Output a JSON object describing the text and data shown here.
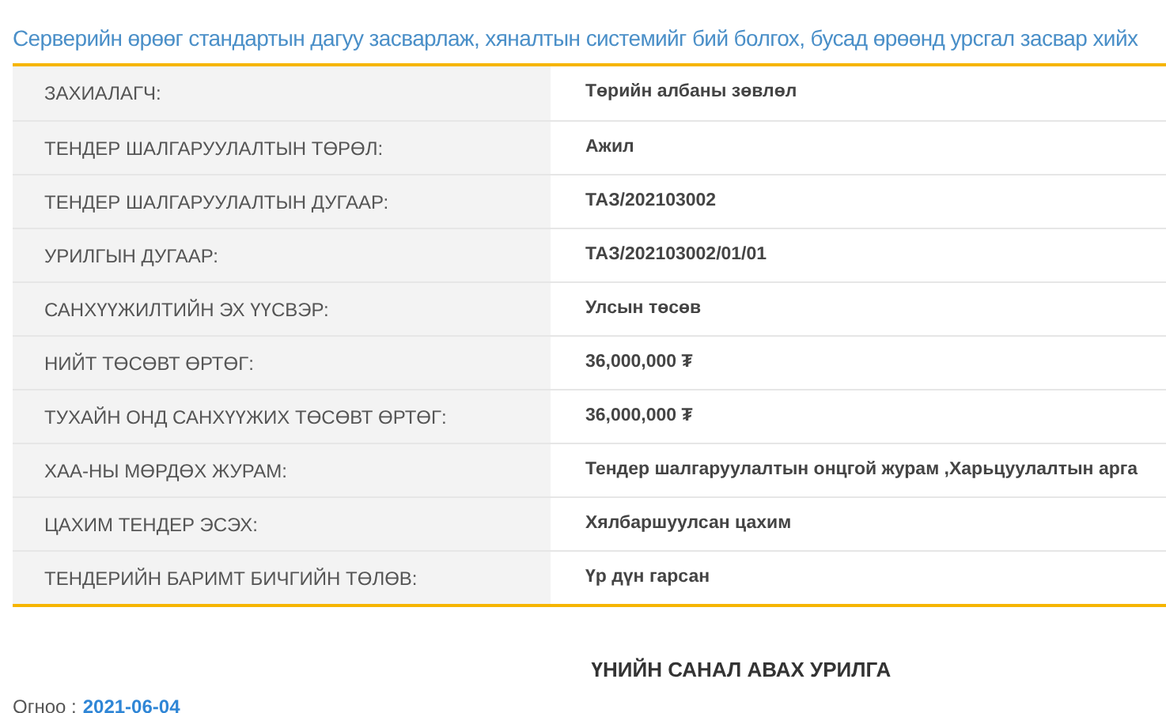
{
  "title": "Серверийн өрөөг стандартын дагуу засварлаж, хяналтын системийг бий болгох, бусад өрөөнд урсгал засвар хийх",
  "details": [
    {
      "label": "ЗАХИАЛАГЧ:",
      "value": "Төрийн албаны зөвлөл"
    },
    {
      "label": "ТЕНДЕР ШАЛГАРУУЛАЛТЫН ТӨРӨЛ:",
      "value": "Ажил"
    },
    {
      "label": "ТЕНДЕР ШАЛГАРУУЛАЛТЫН ДУГААР:",
      "value": "ТАЗ/202103002"
    },
    {
      "label": "УРИЛГЫН ДУГААР:",
      "value": "ТАЗ/202103002/01/01"
    },
    {
      "label": "САНХҮҮЖИЛТИЙН ЭХ ҮҮСВЭР:",
      "value": "Улсын төсөв"
    },
    {
      "label": "НИЙТ ТӨСӨВТ ӨРТӨГ:",
      "value": "36,000,000 ₮"
    },
    {
      "label": "ТУХАЙН ОНД САНХҮҮЖИХ ТӨСӨВТ ӨРТӨГ:",
      "value": "36,000,000 ₮"
    },
    {
      "label": "ХАА-НЫ МӨРДӨХ ЖУРАМ:",
      "value": "Тендер шалгаруулалтын онцгой журам ,Харьцуулалтын арга"
    },
    {
      "label": "ЦАХИМ ТЕНДЕР ЭСЭХ:",
      "value": "Хялбаршуулсан цахим"
    },
    {
      "label": "ТЕНДЕРИЙН БАРИМТ БИЧГИЙН ТӨЛӨВ:",
      "value": "Үр дүн гарсан"
    }
  ],
  "section_heading": "ҮНИЙН САНАЛ АВАХ УРИЛГА",
  "date": {
    "label": "Огноо :",
    "value": "2021-06-04"
  }
}
